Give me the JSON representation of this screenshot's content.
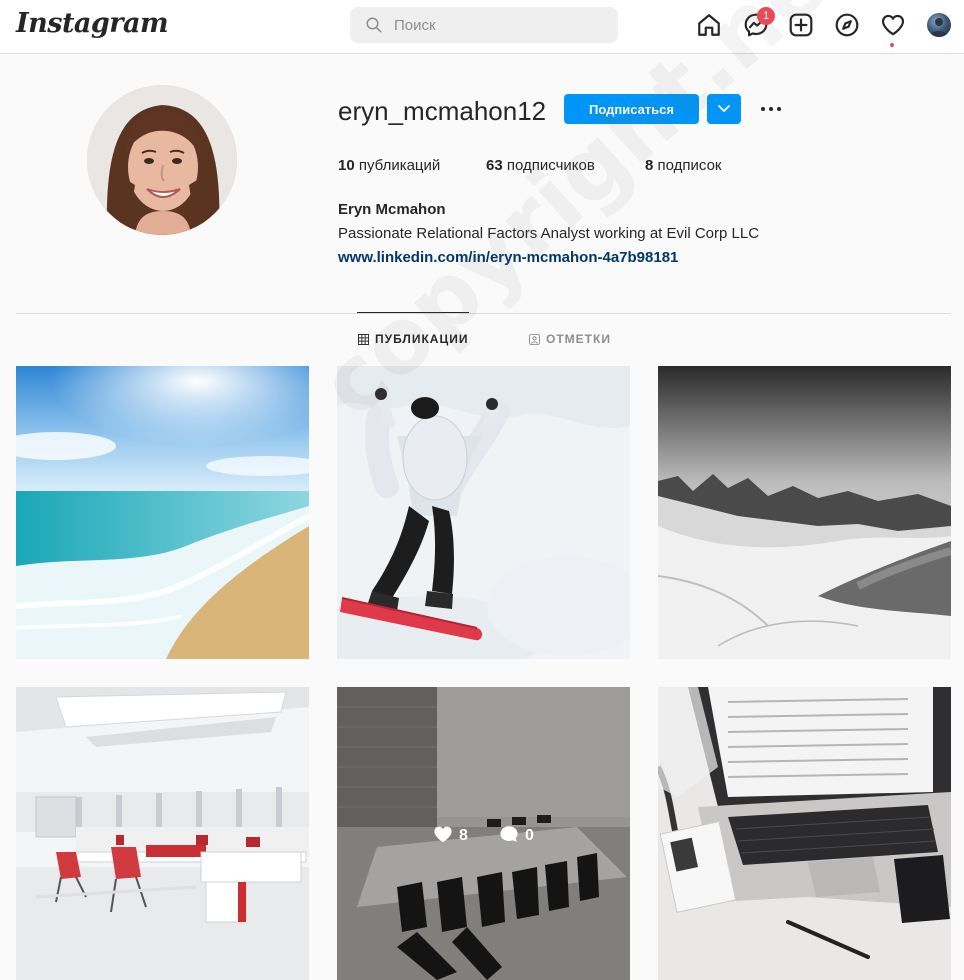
{
  "header": {
    "logo": "Instagram",
    "search_placeholder": "Поиск",
    "messages_badge": "1",
    "icons": [
      "home-icon",
      "messenger-icon",
      "new-post-icon",
      "explore-icon",
      "activity-heart-icon",
      "profile-avatar"
    ]
  },
  "profile": {
    "username": "eryn_mcmahon12",
    "follow_label": "Подписаться",
    "posts_count": "10",
    "posts_label": "публикаций",
    "followers_count": "63",
    "followers_label": "подписчиков",
    "following_count": "8",
    "following_label": "подписок",
    "full_name": "Eryn Mcmahon",
    "bio": "Passionate Relational Factors Analyst working at Evil Corp LLC",
    "website": "www.linkedin.com/in/eryn-mcmahon-4a7b98181"
  },
  "tabs": {
    "posts": "ПУБЛИКАЦИИ",
    "tagged": "ОТМЕТКИ"
  },
  "grid": {
    "hover": {
      "likes": "8",
      "comments": "0"
    }
  },
  "watermark": "copyright.net",
  "colors": {
    "accent": "#0095f6",
    "badge": "#ed4956",
    "link": "#00376b"
  }
}
